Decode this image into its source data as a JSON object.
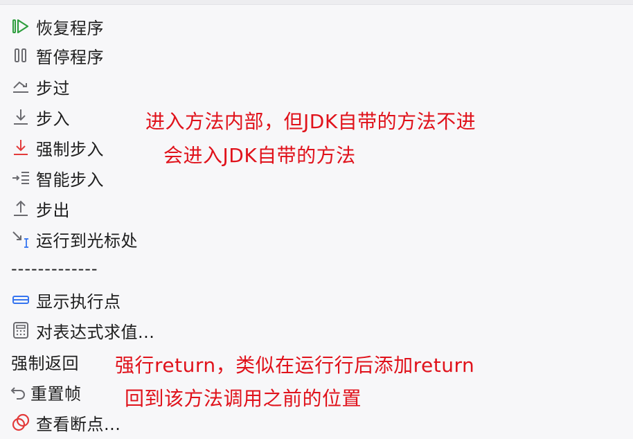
{
  "menu": {
    "resume": {
      "label": "恢复程序",
      "icon": "resume-icon"
    },
    "pause": {
      "label": "暂停程序",
      "icon": "pause-icon"
    },
    "step_over": {
      "label": "步过",
      "icon": "step-over-icon"
    },
    "step_into": {
      "label": "步入",
      "icon": "step-into-icon"
    },
    "force_step_into": {
      "label": "强制步入",
      "icon": "force-step-into-icon"
    },
    "smart_step_into": {
      "label": "智能步入",
      "icon": "smart-step-into-icon"
    },
    "step_out": {
      "label": "步出",
      "icon": "step-out-icon"
    },
    "run_to_cursor": {
      "label": "运行到光标处",
      "icon": "run-to-cursor-icon"
    },
    "separator": "-------------",
    "show_execution_point": {
      "label": "显示执行点",
      "icon": "execution-point-icon"
    },
    "evaluate_expression": {
      "label": "对表达式求值...",
      "icon": "calculator-icon"
    },
    "force_return": {
      "label": "强制返回"
    },
    "drop_frame": {
      "label": "重置帧",
      "icon": "undo-icon"
    },
    "view_breakpoints": {
      "label": "查看断点...",
      "icon": "breakpoints-icon"
    }
  },
  "annotations": {
    "step_into_note": "进入方法内部，但JDK自带的方法不进",
    "force_step_into_note": "会进入JDK自带的方法",
    "force_return_note": "强行return，类似在运行行后添加return",
    "drop_frame_note": "回到该方法调用之前的位置"
  },
  "colors": {
    "annotation": "#e0121b",
    "resume_icon": "#2e9e3e",
    "accent_blue": "#3574f0",
    "breakpoint_red": "#e33b3b"
  }
}
